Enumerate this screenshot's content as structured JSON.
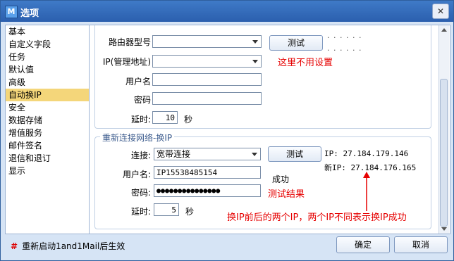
{
  "window": {
    "title": "选项",
    "close_symbol": "✕"
  },
  "sidebar": {
    "items": [
      {
        "label": "基本"
      },
      {
        "label": "自定义字段"
      },
      {
        "label": "任务"
      },
      {
        "label": "默认值"
      },
      {
        "label": "高级"
      },
      {
        "label": "自动换IP"
      },
      {
        "label": "安全"
      },
      {
        "label": "数据存储"
      },
      {
        "label": "增值服务"
      },
      {
        "label": "邮件签名"
      },
      {
        "label": "退信和退订"
      },
      {
        "label": "显示"
      }
    ],
    "selected_index": 5
  },
  "router_section": {
    "model_label": "路由器型号",
    "model_value": "",
    "ip_label": "IP(管理地址)",
    "ip_value": "",
    "username_label": "用户名",
    "username_value": "",
    "password_label": "密码",
    "password_value": "",
    "delay_label": "延时:",
    "delay_value": "10",
    "delay_unit": "秒",
    "test_button": "测试",
    "dots1": "· · · · · ·",
    "dots2": "· · · · · ·",
    "annotation": "这里不用设置"
  },
  "reconnect_section": {
    "title": "重新连接网络-换IP",
    "connection_label": "连接:",
    "connection_value": "宽带连接",
    "username_label": "用户名:",
    "username_value": "IP15538485154",
    "password_label": "密码:",
    "password_value": "●●●●●●●●●●●●●●●",
    "delay_label": "延时:",
    "delay_value": "5",
    "delay_unit": "秒",
    "test_button": "测试",
    "old_ip": "IP: 27.184.179.146",
    "new_ip": "新IP: 27.184.176.165",
    "status": "成功",
    "annotation_result": "测试结果",
    "annotation_explain": "换IP前后的两个IP，两个IP不同表示换IP成功"
  },
  "footer": {
    "restart_note": "重新启动1and1Mail后生效",
    "ok_button": "确定",
    "cancel_button": "取消"
  },
  "colors": {
    "annotation": "#e60000",
    "selection": "#f4d67a",
    "titlebar": "#2b5fae"
  }
}
